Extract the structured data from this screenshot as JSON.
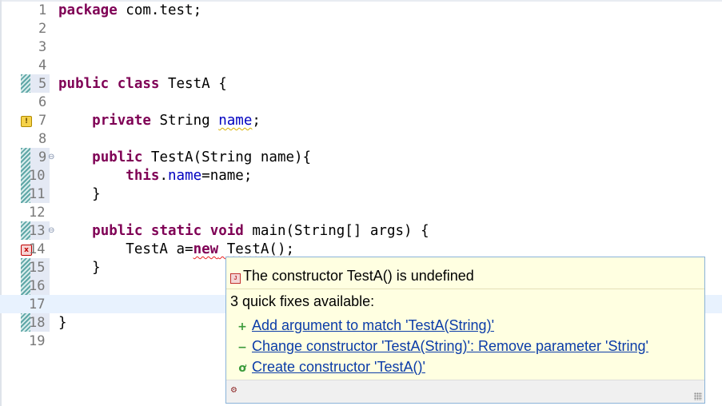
{
  "editor": {
    "lines": [
      {
        "num": "1",
        "code": "package com.test;"
      },
      {
        "num": "2",
        "code": ""
      },
      {
        "num": "3",
        "code": ""
      },
      {
        "num": "4",
        "code": ""
      },
      {
        "num": "5",
        "code": "public class TestA {"
      },
      {
        "num": "6",
        "code": ""
      },
      {
        "num": "7",
        "code": "    private String name;"
      },
      {
        "num": "8",
        "code": ""
      },
      {
        "num": "9",
        "code": "    public TestA(String name){"
      },
      {
        "num": "10",
        "code": "        this.name=name;"
      },
      {
        "num": "11",
        "code": "    }"
      },
      {
        "num": "12",
        "code": ""
      },
      {
        "num": "13",
        "code": "    public static void main(String[] args) {"
      },
      {
        "num": "14",
        "code": "        TestA a=new TestA();"
      },
      {
        "num": "15",
        "code": "    }"
      },
      {
        "num": "16",
        "code": ""
      },
      {
        "num": "17",
        "code": ""
      },
      {
        "num": "18",
        "code": "}"
      },
      {
        "num": "19",
        "code": ""
      }
    ]
  },
  "quickfix": {
    "title": "The constructor TestA() is undefined",
    "count_text": "3 quick fixes available:",
    "fixes": [
      {
        "label": "Add argument to match 'TestA(String)'",
        "icon": "plus-icon"
      },
      {
        "label": "Change constructor 'TestA(String)': Remove parameter 'String'",
        "icon": "minus-icon"
      },
      {
        "label": "Create constructor 'TestA()'",
        "icon": "create-constructor-icon"
      }
    ]
  },
  "colors": {
    "keyword": "#7f0055",
    "field": "#0000c0",
    "link": "#0b3ca8",
    "popup_bg": "#ffffe1",
    "current_line": "#e8f2fe"
  }
}
